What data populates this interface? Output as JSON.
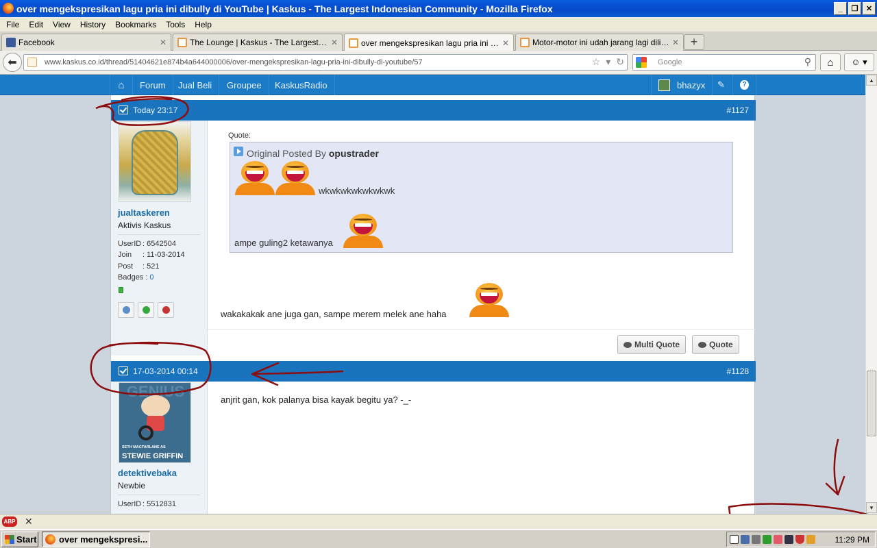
{
  "window": {
    "title": "over mengekspresikan lagu pria ini dibully di YouTube | Kaskus - The Largest Indonesian Community - Mozilla Firefox",
    "buttons": [
      "_",
      "❐",
      "✕"
    ]
  },
  "menu": [
    "File",
    "Edit",
    "View",
    "History",
    "Bookmarks",
    "Tools",
    "Help"
  ],
  "tabs": [
    {
      "title": "Facebook",
      "favicon_color": "#3b5998"
    },
    {
      "title": "The Lounge | Kaskus - The Largest Indon...",
      "favicon_color": "#e8963c"
    },
    {
      "title": "over mengekspresikan lagu pria ini dibully...",
      "favicon_color": "#e8963c"
    },
    {
      "title": "Motor-motor ini udah jarang lagi diliat ga...",
      "favicon_color": "#e8963c"
    }
  ],
  "navbar": {
    "url": "www.kaskus.co.id/thread/51404621e874b4a644000006/over-mengekspresikan-lagu-pria-ini-dibully-di-youtube/57",
    "search_placeholder": "Google"
  },
  "kaskus_nav": {
    "items": [
      "Forum",
      "Jual Beli",
      "Groupee",
      "KaskusRadio"
    ],
    "username": "bhazyx"
  },
  "posts": [
    {
      "date": "Today 23:17",
      "number": "#1127",
      "user": {
        "name": "jualtaskeren",
        "rank": "Aktivis Kaskus",
        "userid_label": "UserID",
        "userid": ": 6542504",
        "join_label": "Join",
        "join": ": 11-03-2014",
        "post_label": "Post",
        "post": ": 521",
        "badges_label": "Badges :",
        "badges": "0"
      },
      "quote": {
        "label": "Quote:",
        "original_prefix": "Original Posted By",
        "author": "opustrader",
        "line1": "wkwkwkwkwkwkwk",
        "line2": "ampe guling2 ketawanya"
      },
      "text": "wakakakak ane juga gan, sampe merem melek ane haha",
      "buttons": {
        "multi_quote": "Multi Quote",
        "quote": "Quote"
      }
    },
    {
      "date": "17-03-2014 00:14",
      "number": "#1128",
      "user": {
        "name": "detektivebaka",
        "rank": "Newbie",
        "userid_label": "UserID",
        "userid": ": 5512831",
        "avatar_text_top": "GENIUS",
        "avatar_text_mid": "SETH MACFARLANE AS",
        "avatar_text_bottom": "STEWIE GRIFFIN"
      },
      "text": "anjrit gan, kok palanya bisa kayak begitu ya? -_-"
    }
  ],
  "addonbar": {
    "abp": "ABP"
  },
  "taskbar": {
    "start": "Start",
    "item": "over mengekspresi...",
    "clock": "11:29 PM"
  },
  "annotation_color": "#8b0d0d"
}
